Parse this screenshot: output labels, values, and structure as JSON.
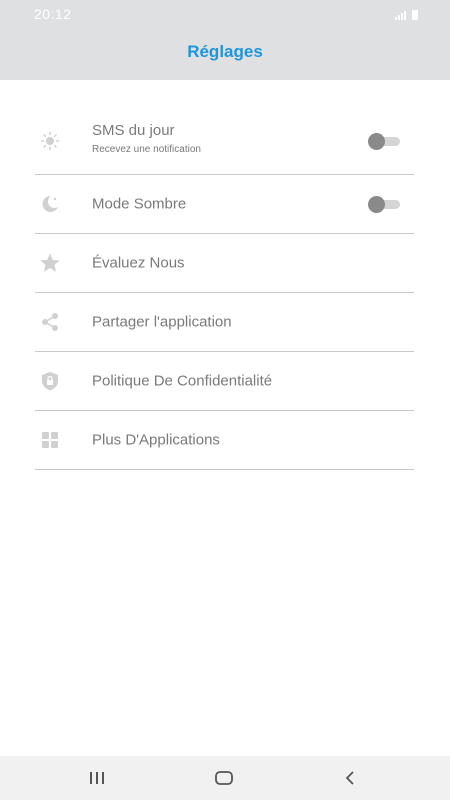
{
  "status": {
    "time": "20:12"
  },
  "header": {
    "title": "Réglages"
  },
  "colors": {
    "accent": "#1f96d9",
    "header_bg": "#dfe0e1",
    "text": "#7a7a7a"
  },
  "settings": {
    "items": [
      {
        "label": "SMS du jour",
        "subtitle": "Recevez une notification",
        "icon": "sun-icon",
        "toggle": false
      },
      {
        "label": "Mode Sombre",
        "icon": "moon-icon",
        "toggle": false
      },
      {
        "label": "Évaluez Nous",
        "icon": "star-icon"
      },
      {
        "label": "Partager l'application",
        "icon": "share-icon"
      },
      {
        "label": "Politique De Confidentialité",
        "icon": "shield-lock-icon"
      },
      {
        "label": "Plus D'Applications",
        "icon": "grid-icon"
      }
    ]
  },
  "navbar": {
    "buttons": [
      "recent-apps-icon",
      "home-icon",
      "back-icon"
    ]
  }
}
